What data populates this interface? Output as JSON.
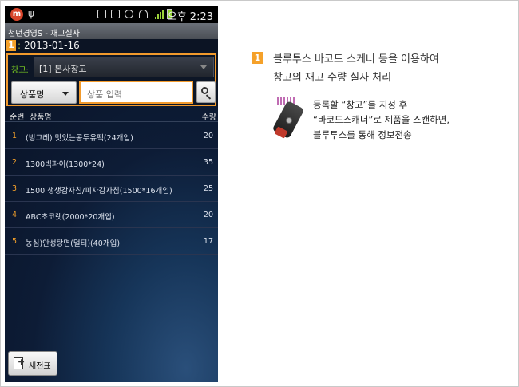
{
  "status_bar": {
    "logo": "m",
    "time": "오후 2:23"
  },
  "app": {
    "title": "천년경영S - 재고실사"
  },
  "date_row": {
    "badge": "1",
    "separator": ":",
    "date": "2013-01-16"
  },
  "warehouse": {
    "label": "창고:",
    "value": "[1] 본사창고"
  },
  "search": {
    "category_label": "상품명",
    "placeholder": "상품 입력"
  },
  "list": {
    "headers": {
      "no": "순번",
      "name": "상품명",
      "qty": "수량"
    },
    "rows": [
      {
        "no": "1",
        "name": "(빙그레) 맛있는콩두유팩(24개입)",
        "qty": "20"
      },
      {
        "no": "2",
        "name": "1300빅파이(1300*24)",
        "qty": "35"
      },
      {
        "no": "3",
        "name": "1500 생생감자칩/피자감자칩(1500*16개입)",
        "qty": "25"
      },
      {
        "no": "4",
        "name": "ABC초코렛(2000*20개입)",
        "qty": "20"
      },
      {
        "no": "5",
        "name": "농심)안성탕면(멀티)(40개입)",
        "qty": "17"
      }
    ]
  },
  "new_button": {
    "label": "새전표"
  },
  "annotation": {
    "badge": "1",
    "line1": "블루투스 바코드 스케너 등을 이용하여",
    "line2": "창고의 재고 수량 실사 처리",
    "desc1": "등록할 “창고”를 지정 후",
    "desc2": "“바코드스캐너”로 제품을 스캔하면,",
    "desc3": "블루투스를 통해 정보전송"
  },
  "colors": {
    "accent": "#f5a12a",
    "warehouse_label": "#7ed321",
    "list_bg": "#0d1c36"
  }
}
